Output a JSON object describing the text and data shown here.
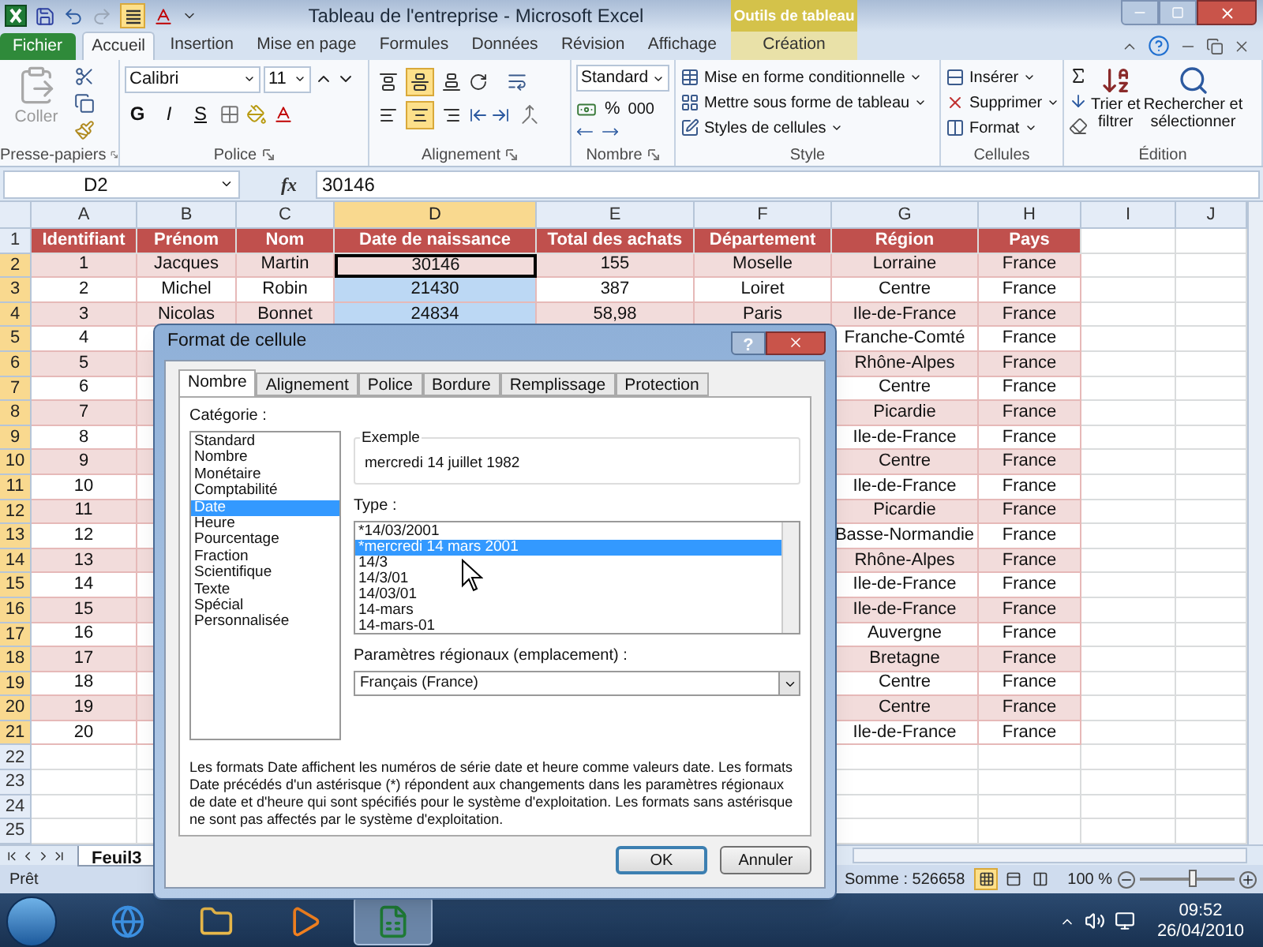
{
  "window": {
    "title": "Tableau de l'entreprise - Microsoft Excel",
    "context_group": "Outils de tableau"
  },
  "quick_access": {
    "align_active": true
  },
  "ribbon_tabs": [
    {
      "label": "Fichier",
      "kind": "file",
      "selected": false
    },
    {
      "label": "Accueil",
      "kind": "tab",
      "selected": true
    },
    {
      "label": "Insertion",
      "kind": "tab",
      "selected": false
    },
    {
      "label": "Mise en page",
      "kind": "tab",
      "selected": false
    },
    {
      "label": "Formules",
      "kind": "tab",
      "selected": false
    },
    {
      "label": "Données",
      "kind": "tab",
      "selected": false
    },
    {
      "label": "Révision",
      "kind": "tab",
      "selected": false
    },
    {
      "label": "Affichage",
      "kind": "tab",
      "selected": false
    },
    {
      "label": "Création",
      "kind": "context",
      "selected": false
    }
  ],
  "ribbon": {
    "clipboard": {
      "paste": "Coller",
      "paste_disabled": true,
      "label": "Presse-papiers"
    },
    "font": {
      "name": "Calibri",
      "size": "11",
      "bold": "G",
      "italic": "I",
      "underline": "S",
      "label": "Police"
    },
    "alignment": {
      "label": "Alignement",
      "vertical": [
        {
          "kind": "top",
          "selected": false
        },
        {
          "kind": "middle",
          "selected": true
        },
        {
          "kind": "bottom",
          "selected": false
        }
      ],
      "horizontal": [
        {
          "kind": "left",
          "selected": false
        },
        {
          "kind": "center",
          "selected": true
        },
        {
          "kind": "right",
          "selected": false
        }
      ]
    },
    "number": {
      "format": "Standard",
      "percent": "%",
      "thousands": "000",
      "label": "Nombre"
    },
    "style": {
      "items": [
        "Mise en forme conditionnelle",
        "Mettre sous forme de tableau",
        "Styles de cellules"
      ],
      "label": "Style"
    },
    "cells": {
      "items": [
        "Insérer",
        "Supprimer",
        "Format"
      ],
      "label": "Cellules"
    },
    "editing": {
      "sort": [
        "Trier et",
        "filtrer"
      ],
      "find": [
        "Rechercher et",
        "sélectionner"
      ],
      "label": "Édition"
    }
  },
  "formula_bar": {
    "name_box": "D2",
    "fx": "fx",
    "value": "30146"
  },
  "sheet": {
    "columns": [
      {
        "label": "A",
        "selected": false
      },
      {
        "label": "B",
        "selected": false
      },
      {
        "label": "C",
        "selected": false
      },
      {
        "label": "D",
        "selected": true
      },
      {
        "label": "E",
        "selected": false
      },
      {
        "label": "F",
        "selected": false
      },
      {
        "label": "G",
        "selected": false
      },
      {
        "label": "H",
        "selected": false
      },
      {
        "label": "I",
        "selected": false
      },
      {
        "label": "J",
        "selected": false
      }
    ],
    "rows": [
      {
        "label": "1",
        "kind": "header",
        "selected": false,
        "covered": false,
        "cells": [
          {
            "text": "Identifiant"
          },
          {
            "text": "Prénom"
          },
          {
            "text": "Nom"
          },
          {
            "text": "Date de naissance"
          },
          {
            "text": "Total des achats"
          },
          {
            "text": "Département"
          },
          {
            "text": "Région"
          },
          {
            "text": "Pays"
          }
        ]
      },
      {
        "label": "2",
        "kind": "band",
        "selected": true,
        "covered": false,
        "cells": [
          {
            "text": "1"
          },
          {
            "text": "Jacques"
          },
          {
            "text": "Martin"
          },
          {
            "text": "30146",
            "active": true
          },
          {
            "text": "155"
          },
          {
            "text": "Moselle"
          },
          {
            "text": "Lorraine"
          },
          {
            "text": "France"
          }
        ]
      },
      {
        "label": "3",
        "kind": "plain",
        "selected": true,
        "covered": false,
        "cells": [
          {
            "text": "2"
          },
          {
            "text": "Michel"
          },
          {
            "text": "Robin"
          },
          {
            "text": "21430",
            "selected": true
          },
          {
            "text": "387"
          },
          {
            "text": "Loiret"
          },
          {
            "text": "Centre"
          },
          {
            "text": "France"
          }
        ]
      },
      {
        "label": "4",
        "kind": "band",
        "selected": true,
        "covered": false,
        "cells": [
          {
            "text": "3"
          },
          {
            "text": "Nicolas"
          },
          {
            "text": "Bonnet"
          },
          {
            "text": "24834",
            "selected": true
          },
          {
            "text": "58,98"
          },
          {
            "text": "Paris"
          },
          {
            "text": "Ile-de-France"
          },
          {
            "text": "France"
          }
        ]
      },
      {
        "label": "5",
        "kind": "plain",
        "selected": true,
        "covered": true,
        "cells": [
          {
            "text": "4"
          },
          {
            "text": "Franche-Comté"
          },
          {
            "text": "France"
          }
        ]
      },
      {
        "label": "6",
        "kind": "band",
        "selected": true,
        "covered": true,
        "cells": [
          {
            "text": "5"
          },
          {
            "text": "Rhône-Alpes"
          },
          {
            "text": "France"
          }
        ]
      },
      {
        "label": "7",
        "kind": "plain",
        "selected": true,
        "covered": true,
        "cells": [
          {
            "text": "6"
          },
          {
            "text": "Centre"
          },
          {
            "text": "France"
          }
        ]
      },
      {
        "label": "8",
        "kind": "band",
        "selected": true,
        "covered": true,
        "cells": [
          {
            "text": "7"
          },
          {
            "text": "Picardie"
          },
          {
            "text": "France"
          }
        ]
      },
      {
        "label": "9",
        "kind": "plain",
        "selected": true,
        "covered": true,
        "cells": [
          {
            "text": "8"
          },
          {
            "text": "Ile-de-France"
          },
          {
            "text": "France"
          }
        ]
      },
      {
        "label": "10",
        "kind": "band",
        "selected": true,
        "covered": true,
        "cells": [
          {
            "text": "9"
          },
          {
            "text": "Centre"
          },
          {
            "text": "France"
          }
        ]
      },
      {
        "label": "11",
        "kind": "plain",
        "selected": true,
        "covered": true,
        "cells": [
          {
            "text": "10"
          },
          {
            "text": "Ile-de-France"
          },
          {
            "text": "France"
          }
        ]
      },
      {
        "label": "12",
        "kind": "band",
        "selected": true,
        "covered": true,
        "cells": [
          {
            "text": "11"
          },
          {
            "text": "Picardie"
          },
          {
            "text": "France"
          }
        ]
      },
      {
        "label": "13",
        "kind": "plain",
        "selected": true,
        "covered": true,
        "cells": [
          {
            "text": "12"
          },
          {
            "text": "Basse-Normandie"
          },
          {
            "text": "France"
          }
        ]
      },
      {
        "label": "14",
        "kind": "band",
        "selected": true,
        "covered": true,
        "cells": [
          {
            "text": "13"
          },
          {
            "text": "Rhône-Alpes"
          },
          {
            "text": "France"
          }
        ]
      },
      {
        "label": "15",
        "kind": "plain",
        "selected": true,
        "covered": true,
        "cells": [
          {
            "text": "14"
          },
          {
            "text": "Ile-de-France"
          },
          {
            "text": "France"
          }
        ]
      },
      {
        "label": "16",
        "kind": "band",
        "selected": true,
        "covered": true,
        "cells": [
          {
            "text": "15"
          },
          {
            "text": "Ile-de-France"
          },
          {
            "text": "France"
          }
        ]
      },
      {
        "label": "17",
        "kind": "plain",
        "selected": true,
        "covered": true,
        "cells": [
          {
            "text": "16"
          },
          {
            "text": "Auvergne"
          },
          {
            "text": "France"
          }
        ]
      },
      {
        "label": "18",
        "kind": "band",
        "selected": true,
        "covered": true,
        "cells": [
          {
            "text": "17"
          },
          {
            "text": "Bretagne"
          },
          {
            "text": "France"
          }
        ]
      },
      {
        "label": "19",
        "kind": "plain",
        "selected": true,
        "covered": true,
        "cells": [
          {
            "text": "18"
          },
          {
            "text": "Centre"
          },
          {
            "text": "France"
          }
        ]
      },
      {
        "label": "20",
        "kind": "band",
        "selected": true,
        "covered": true,
        "cells": [
          {
            "text": "19"
          },
          {
            "text": "Centre"
          },
          {
            "text": "France"
          }
        ]
      },
      {
        "label": "21",
        "kind": "plain",
        "selected": true,
        "covered": true,
        "cells": [
          {
            "text": "20"
          },
          {
            "text": "Ile-de-France"
          },
          {
            "text": "France"
          }
        ]
      },
      {
        "label": "22",
        "kind": "empty",
        "selected": false
      },
      {
        "label": "23",
        "kind": "empty",
        "selected": false
      },
      {
        "label": "24",
        "kind": "empty",
        "selected": false
      },
      {
        "label": "25",
        "kind": "empty",
        "selected": false
      }
    ]
  },
  "sheet_tabs": [
    {
      "label": "Feuil3",
      "selected": true
    }
  ],
  "status_bar": {
    "ready": "Prêt",
    "sum": "Somme : 526658",
    "views": [
      {
        "kind": "normal",
        "selected": true
      },
      {
        "kind": "layout",
        "selected": false
      },
      {
        "kind": "break",
        "selected": false
      }
    ],
    "zoom": "100 %",
    "zoom_slider": {
      "level": 0.55
    }
  },
  "dialog": {
    "title": "Format de cellule",
    "help": "?",
    "tabs": [
      {
        "label": "Nombre",
        "selected": true
      },
      {
        "label": "Alignement",
        "selected": false
      },
      {
        "label": "Police",
        "selected": false
      },
      {
        "label": "Bordure",
        "selected": false
      },
      {
        "label": "Remplissage",
        "selected": false
      },
      {
        "label": "Protection",
        "selected": false
      }
    ],
    "category_label": "Catégorie :",
    "categories": [
      {
        "label": "Standard",
        "selected": false
      },
      {
        "label": "Nombre",
        "selected": false
      },
      {
        "label": "Monétaire",
        "selected": false
      },
      {
        "label": "Comptabilité",
        "selected": false
      },
      {
        "label": "Date",
        "selected": true
      },
      {
        "label": "Heure",
        "selected": false
      },
      {
        "label": "Pourcentage",
        "selected": false
      },
      {
        "label": "Fraction",
        "selected": false
      },
      {
        "label": "Scientifique",
        "selected": false
      },
      {
        "label": "Texte",
        "selected": false
      },
      {
        "label": "Spécial",
        "selected": false
      },
      {
        "label": "Personnalisée",
        "selected": false
      }
    ],
    "example_label": "Exemple",
    "example": "mercredi 14 juillet 1982",
    "type_label": "Type :",
    "types": [
      {
        "label": "*14/03/2001",
        "selected": false
      },
      {
        "label": "*mercredi 14 mars 2001",
        "selected": true
      },
      {
        "label": "14/3",
        "selected": false
      },
      {
        "label": "14/3/01",
        "selected": false
      },
      {
        "label": "14/03/01",
        "selected": false
      },
      {
        "label": "14-mars",
        "selected": false
      },
      {
        "label": "14-mars-01",
        "selected": false
      }
    ],
    "locale_label": "Paramètres régionaux (emplacement) :",
    "locale": "Français (France)",
    "description": "Les formats Date affichent les numéros de série date et heure comme valeurs date. Les formats Date précédés d'un astérisque (*) répondent aux changements dans les paramètres régionaux de date et d'heure qui sont spécifiés pour le système d'exploitation. Les formats sans astérisque ne sont pas affectés par le système d'exploitation.",
    "buttons": [
      {
        "label": "OK",
        "kind": "default"
      },
      {
        "label": "Annuler",
        "kind": "normal"
      }
    ]
  },
  "taskbar": {
    "apps": [
      {
        "kind": "browser",
        "selected": false
      },
      {
        "kind": "folder",
        "selected": false
      },
      {
        "kind": "media",
        "selected": false
      },
      {
        "kind": "spreadsheet",
        "selected": true
      }
    ],
    "time": "09:52",
    "date": "26/04/2010"
  }
}
